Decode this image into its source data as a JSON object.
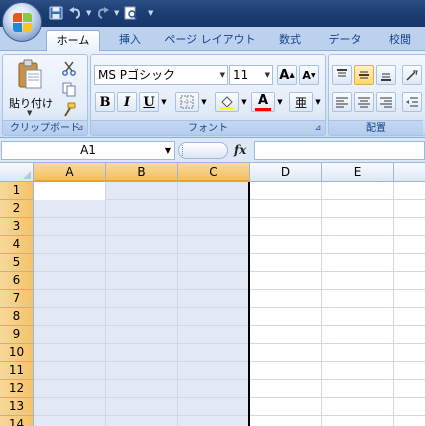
{
  "quick_access": {
    "icons": [
      "save-icon",
      "undo-icon",
      "redo-icon",
      "print-preview-icon",
      "customize-qat-icon"
    ]
  },
  "tabs": [
    {
      "label": "ホーム",
      "active": true
    },
    {
      "label": "挿入",
      "active": false
    },
    {
      "label": "ページ レイアウト",
      "active": false
    },
    {
      "label": "数式",
      "active": false
    },
    {
      "label": "データ",
      "active": false
    },
    {
      "label": "校閲",
      "active": false
    }
  ],
  "ribbon": {
    "clipboard": {
      "paste_label": "貼り付け",
      "group_label": "クリップボード"
    },
    "font": {
      "font_name": "MS Pゴシック",
      "font_size": "11",
      "bold": "B",
      "italic": "I",
      "underline": "U",
      "grow": "A",
      "shrink": "A",
      "font_color_glyph": "A",
      "phonetic_glyph": "亜",
      "group_label": "フォント"
    },
    "alignment": {
      "group_label": "配置"
    }
  },
  "formula_bar": {
    "name_box": "A1",
    "fx_label": "fx",
    "formula": ""
  },
  "grid": {
    "columns": [
      "A",
      "B",
      "C",
      "D",
      "E"
    ],
    "selected_columns": [
      "A",
      "B",
      "C"
    ],
    "rows": [
      "1",
      "2",
      "3",
      "4",
      "5",
      "6",
      "7",
      "8",
      "9",
      "10",
      "11",
      "12",
      "13",
      "14"
    ],
    "active_cell": "A1"
  },
  "colors": {
    "titlebar": "#1d3e73",
    "ribbon": "#dbe7f7",
    "selected_header": "#f1c15f",
    "selection_fill": "#e2e9f4",
    "gridline": "#d0d7e5"
  }
}
